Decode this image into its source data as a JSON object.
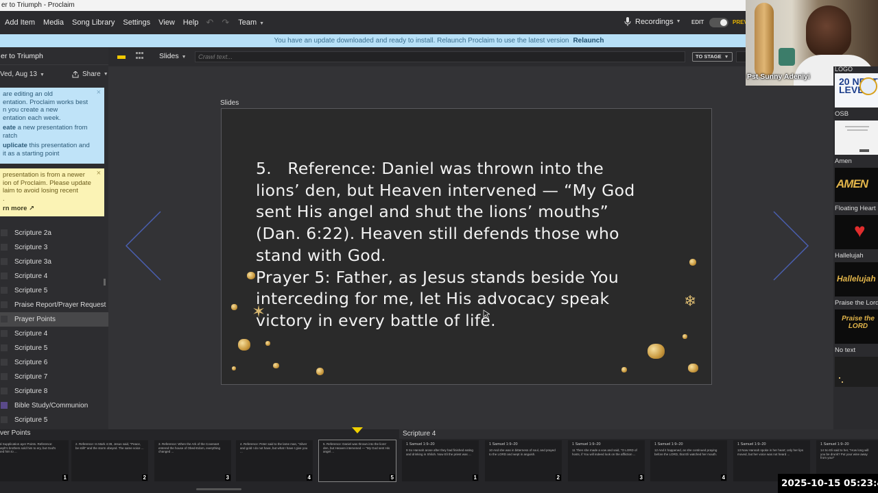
{
  "window_title": "er to Triumph - Proclaim",
  "menu": {
    "add_item": "Add Item",
    "media": "Media",
    "song_library": "Song Library",
    "settings": "Settings",
    "view": "View",
    "help": "Help",
    "team": "Team",
    "recordings": "Recordings",
    "edit": "EDIT",
    "preview": "PREV"
  },
  "banner": {
    "text": "You have an update downloaded and ready to install. Relaunch Proclaim to use the latest version",
    "action": "Relaunch"
  },
  "sidebar": {
    "presentation_title": "er to Triumph",
    "date": "Ved, Aug 13",
    "share": "Share",
    "info_note": {
      "line1": "are editing an old",
      "line2": "entation. Proclaim works best",
      "line3": "n you create a new",
      "line4": "entation each week.",
      "create_bold": "eate",
      "create_rest": " a new presentation from",
      "create_rest2": "ratch",
      "dup_bold": "uplicate",
      "dup_rest": " this presentation and",
      "dup_rest2": "it as a starting point"
    },
    "warn_note": {
      "line1": "presentation is from a newer",
      "line2": "ion of Proclaim. Please update",
      "line3": "laim to avoid losing recent",
      "line4": ".",
      "learn_more": "rn more"
    },
    "items": [
      {
        "label": "Scripture 2a"
      },
      {
        "label": "Scripture 3"
      },
      {
        "label": "Scripture 3a"
      },
      {
        "label": "Scripture 4"
      },
      {
        "label": "Scripture 5"
      },
      {
        "label": "Praise Report/Prayer Request"
      },
      {
        "label": "Prayer Points"
      },
      {
        "label": "Scripture 4"
      },
      {
        "label": "Scripture 5"
      },
      {
        "label": "Scripture 6"
      },
      {
        "label": "Scripture 7"
      },
      {
        "label": "Scripture 8"
      },
      {
        "label": "Bible Study/Communion"
      },
      {
        "label": "Scripture 5"
      }
    ]
  },
  "toolbar": {
    "slides_label": "Slides",
    "crawl_placeholder": "Crawl text...",
    "to_stage": "TO STAGE"
  },
  "main": {
    "section_label": "Slides",
    "slide_lines": [
      "5.   Reference: Daniel was thrown into the",
      "lions’ den, but Heaven intervened — “My God",
      "sent His angel and shut the lions’ mouths”",
      "(Dan. 6:22). Heaven still defends those who",
      "stand with God.",
      "Prayer 5: Father, as Jesus stands beside You",
      "interceding for me, let His advocacy speak",
      "victory in every battle of life."
    ]
  },
  "video_overlay": {
    "name": "Pst Sunny Adeniyi"
  },
  "right_panel": {
    "items": [
      {
        "label": "LOGO",
        "thumb_text": "20 NEXT LEVEL"
      },
      {
        "label": "OSB",
        "thumb_text": ""
      },
      {
        "label": "Amen",
        "thumb_text": "AMEN"
      },
      {
        "label": "Floating Heart",
        "thumb_text": ""
      },
      {
        "label": "Hallelujah",
        "thumb_text": "Hallelujah"
      },
      {
        "label": "Praise the Lord",
        "thumb_text": "Praise the LORD"
      },
      {
        "label": "No text",
        "thumb_text": ""
      }
    ]
  },
  "bottom": {
    "left_group": "ver Points",
    "right_group": "Scripture 4",
    "left_thumbs": [
      {
        "num": "1",
        "text": "onal Supplication ayer Points. Reference: Joseph's brothers sold him to ery, but God's raised him to ..."
      },
      {
        "num": "2",
        "text": "2. Reference: In Mark 4:39, Jesus said, \"Peace, be still!\" and the storm obeyed. The same voice ..."
      },
      {
        "num": "3",
        "text": "3. Reference: When the Ark of the Covenant entered the house of Obed-Edom, everything changed ..."
      },
      {
        "num": "4",
        "text": "4. Reference: Peter said to the lame man, \"Silver and gold I do not have, but what I have I give you ..."
      },
      {
        "num": "5",
        "text": "5. Reference: Daniel was thrown into the lions' den, but Heaven intervened — \"My God sent His angel ..."
      }
    ],
    "right_thumbs": [
      {
        "num": "1",
        "head": "1 Samuel 1:9–20",
        "text": "9 So Hannah arose after they had finished eating and drinking in Shiloh. Now Eli the priest was ..."
      },
      {
        "num": "2",
        "head": "1 Samuel 1:9–20",
        "text": "10 And she was in bitterness of soul, and prayed to the LORD and wept in anguish."
      },
      {
        "num": "3",
        "head": "1 Samuel 1:9–20",
        "text": "11 Then she made a vow and said, \"O LORD of hosts, if You will indeed look on the affliction ..."
      },
      {
        "num": "4",
        "head": "1 Samuel 1:9–20",
        "text": "12 And it happened, as she continued praying before the LORD, that Eli watched her mouth."
      },
      {
        "num": "5",
        "head": "1 Samuel 1:9–20",
        "text": "13 Now Hannah spoke in her heart; only her lips moved, but her voice was not heard ..."
      },
      {
        "num": "",
        "head": "1 Samuel 1:9–20",
        "text": "14 So Eli said to her, \"How long will you be drunk? Put your wine away from you!\""
      }
    ]
  },
  "timestamp": "2025-10-15  05:23:4"
}
